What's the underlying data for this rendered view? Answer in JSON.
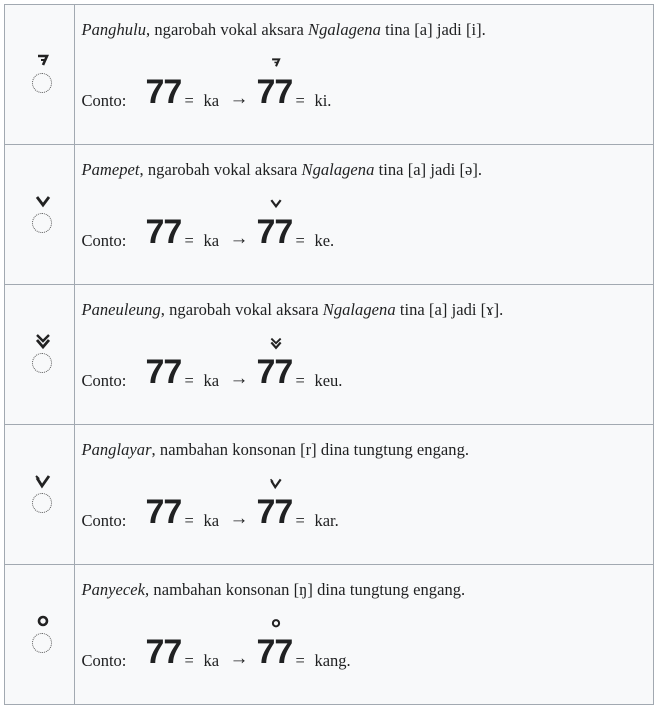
{
  "rows": [
    {
      "name_italic": "Panghulu",
      "desc_a": ", ngarobah vokal aksara ",
      "desc_italic": "Ngalagena",
      "desc_b": " tina [a] jadi [i].",
      "example_label": "Conto:",
      "base_letters": "77",
      "eq": "=",
      "base_reading": "ka",
      "arrow": "→",
      "result_letters": "77",
      "result_reading": "ki.",
      "mark_icon": "panghulu-mark"
    },
    {
      "name_italic": "Pamepet",
      "desc_a": ", ngarobah vokal aksara ",
      "desc_italic": "Ngalagena",
      "desc_b": " tina [a] jadi [ə].",
      "example_label": "Conto:",
      "base_letters": "77",
      "eq": "=",
      "base_reading": "ka",
      "arrow": "→",
      "result_letters": "77",
      "result_reading": "ke.",
      "mark_icon": "pamepet-mark"
    },
    {
      "name_italic": "Paneuleung",
      "desc_a": ", ngarobah vokal aksara ",
      "desc_italic": "Ngalagena",
      "desc_b": " tina [a] jadi [ɤ].",
      "example_label": "Conto:",
      "base_letters": "77",
      "eq": "=",
      "base_reading": "ka",
      "arrow": "→",
      "result_letters": "77",
      "result_reading": "keu.",
      "mark_icon": "paneuleung-mark"
    },
    {
      "name_italic": "Panglayar",
      "desc_a": ", nambahan konsonan [r] dina tungtung engang.",
      "desc_italic": "",
      "desc_b": "",
      "example_label": "Conto:",
      "base_letters": "77",
      "eq": "=",
      "base_reading": "ka",
      "arrow": "→",
      "result_letters": "77",
      "result_reading": "kar.",
      "mark_icon": "panglayar-mark"
    },
    {
      "name_italic": "Panyecek",
      "desc_a": ", nambahan konsonan [ŋ] dina tungtung engang.",
      "desc_italic": "",
      "desc_b": "",
      "example_label": "Conto:",
      "base_letters": "77",
      "eq": "=",
      "base_reading": "ka",
      "arrow": "→",
      "result_letters": "77",
      "result_reading": "kang.",
      "mark_icon": "panyecek-mark"
    }
  ]
}
